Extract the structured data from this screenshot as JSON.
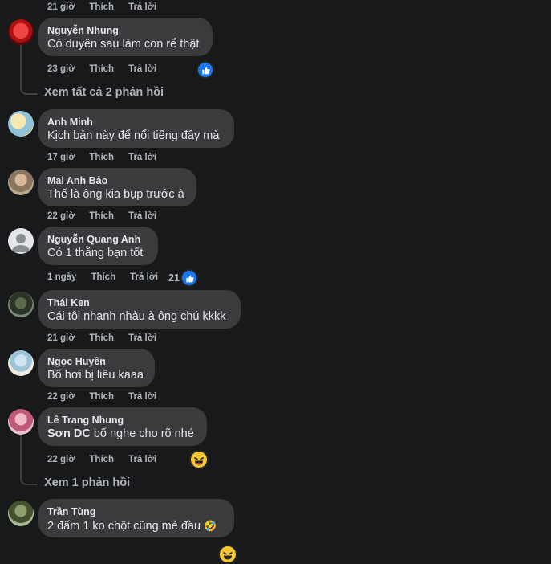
{
  "comments": [
    {
      "time": "21 giờ",
      "like": "Thích",
      "reply": "Trả lời"
    },
    {
      "author": "Nguyễn Nhung",
      "text": "Có duyên sau làm con rể thật",
      "time": "23 giờ",
      "like": "Thích",
      "reply": "Trả lời",
      "reaction": "like"
    },
    {
      "view_replies": "Xem tất cả 2 phản hồi"
    },
    {
      "author": "Anh Minh",
      "text": "Kịch bản này để nổi tiếng đây mà",
      "time": "17 giờ",
      "like": "Thích",
      "reply": "Trả lời"
    },
    {
      "author": "Mai Anh Bảo",
      "text": "Thế là ông kia bụp trước à",
      "time": "22 giờ",
      "like": "Thích",
      "reply": "Trả lời"
    },
    {
      "author": "Nguyễn Quang Anh",
      "text": "Có 1 thằng bạn tốt",
      "time": "1 ngày",
      "like": "Thích",
      "reply": "Trả lời",
      "reaction_count": "21",
      "reaction": "like"
    },
    {
      "author": "Thái Ken",
      "text": "Cái tội nhanh nhảu à ông chú kkkk",
      "time": "21 giờ",
      "like": "Thích",
      "reply": "Trả lời"
    },
    {
      "author": "Ngọc Huyền",
      "text": "Bố hơi bị liều kaaa",
      "time": "22 giờ",
      "like": "Thích",
      "reply": "Trả lời"
    },
    {
      "author": "Lê Trang Nhung",
      "mention": "Sơn DC",
      "text": " bố nghe cho rõ nhé",
      "time": "22 giờ",
      "like": "Thích",
      "reply": "Trả lời",
      "reaction": "haha"
    },
    {
      "view_replies": "Xem 1 phản hồi"
    },
    {
      "author": "Trần Tùng",
      "text": "2 đấm 1 ko chột cũng mẻ đầu",
      "emoji": "🤣"
    }
  ],
  "colors": {
    "background": "#18191a",
    "bubble": "#3a3b3c",
    "text": "#e4e6eb",
    "meta": "#b0b3b8",
    "like_blue": "#1877f2"
  }
}
